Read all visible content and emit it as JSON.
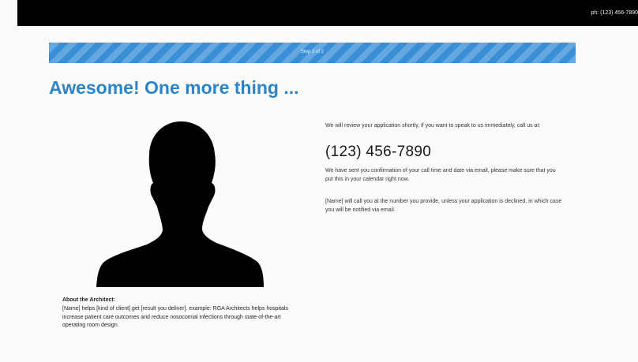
{
  "header": {
    "phone_text": "ph: (123) 456-7890"
  },
  "progress": {
    "label": "Step 2 of 2",
    "fraction": 1.0,
    "color": "#3a8ed6"
  },
  "main": {
    "headline": "Awesome! One more thing ...",
    "headline_color": "#2b84c8",
    "image_icon": "person-silhouette-icon",
    "about": {
      "title": "About the Architect:",
      "body": "[Name] helps [kind of client] get [result you deliver]. example: RGA Architects helps hospitals increase patient care outcomes and reduce nosocomial infections through state-of-the-art operating room design."
    },
    "intro": "We will review your application shortly, if you want to speak to us immediately, call us at:",
    "phone": "(123) 456-7890",
    "confirmation": "We have sent you confirmation of your call time and date via email, please make sure that you put this in your calendar right now.",
    "notice": "[Name] will call you at the number you provide, unless your application is declined, in which case you will be notified via email."
  }
}
